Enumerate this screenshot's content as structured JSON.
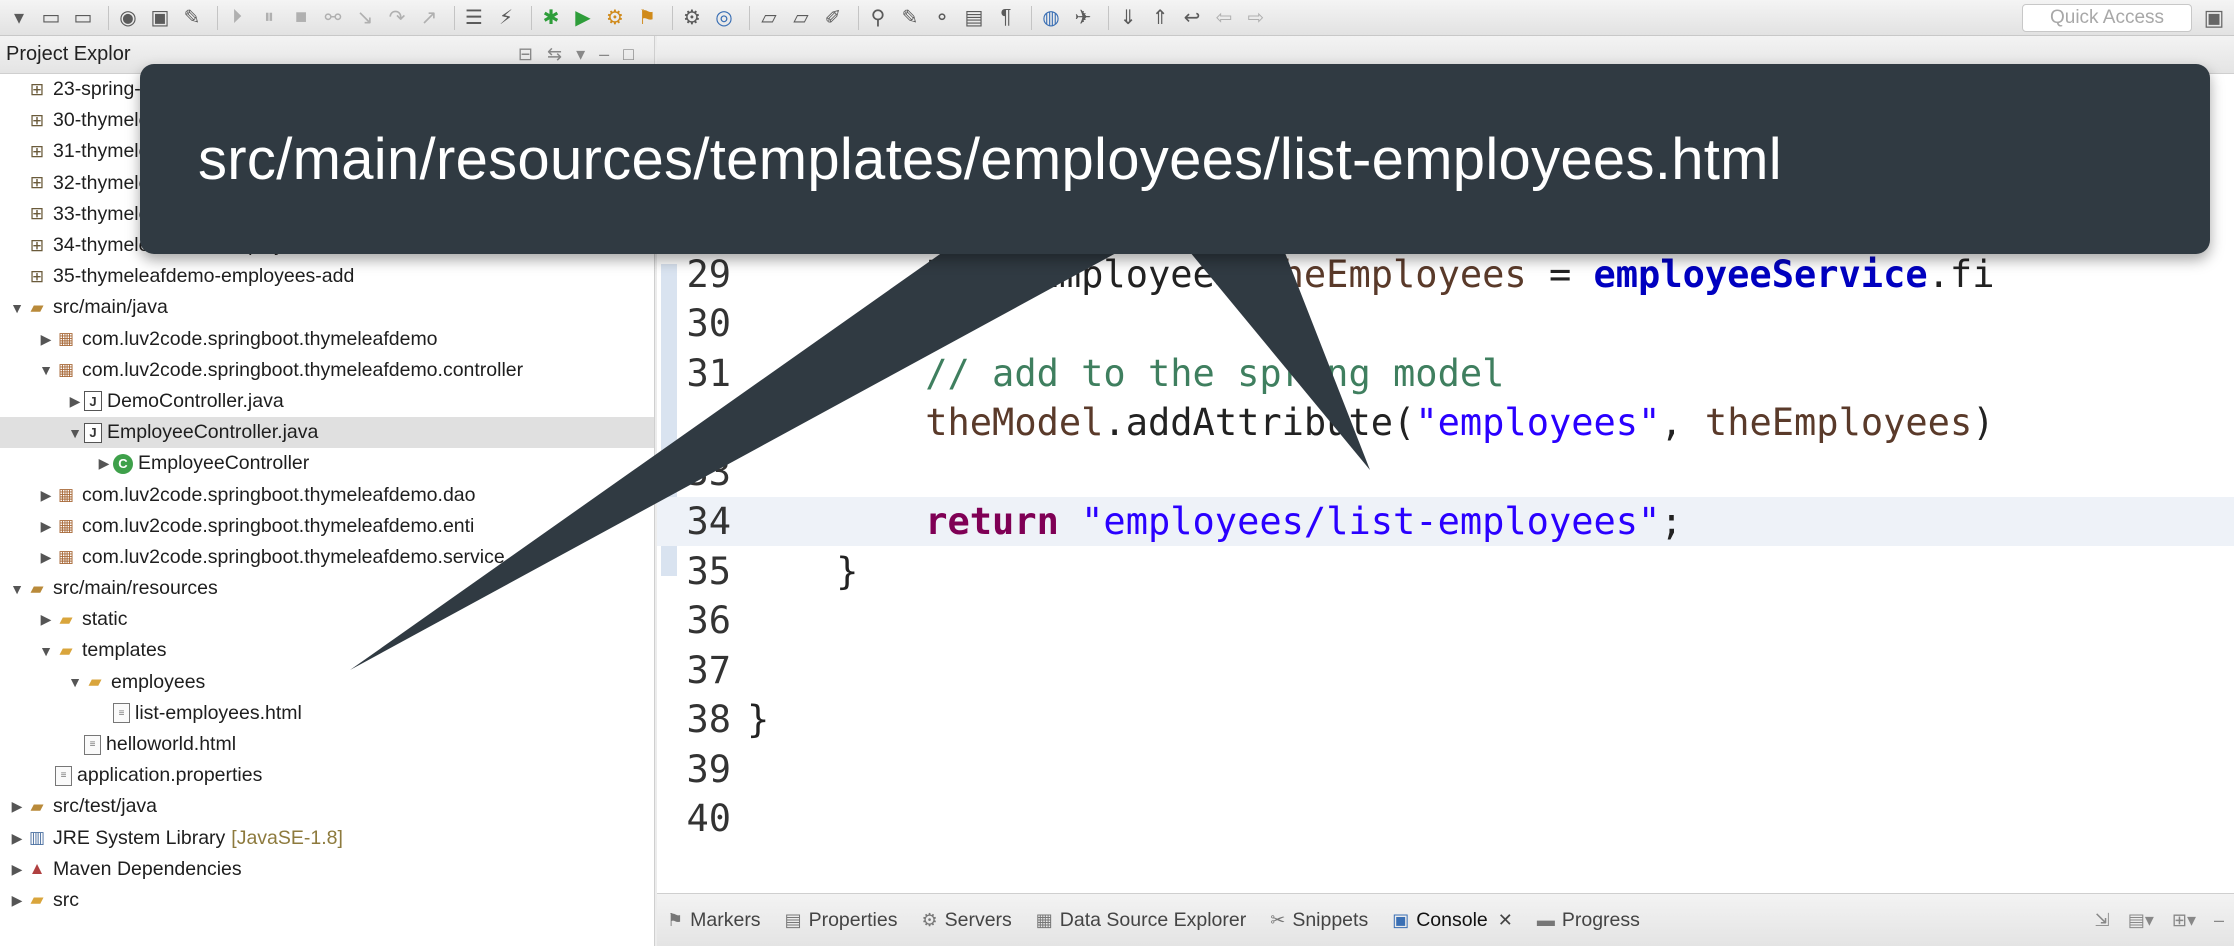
{
  "toolbar": {
    "icons": [
      "new-icon",
      "save-icon",
      "save-all-icon",
      "profile-icon",
      "monitor-icon",
      "pin-icon",
      "step-icon",
      "pause-icon",
      "stop-icon",
      "disconnect-icon",
      "step-into-icon",
      "step-over-icon",
      "step-return-icon",
      "tasks-icon",
      "refactor-icon",
      "debug-icon",
      "run-icon",
      "run-config-icon",
      "external-tools-icon",
      "new-server-icon",
      "new-class-icon",
      "open-folder-icon",
      "open-type-icon",
      "open-resource-icon",
      "search-icon",
      "highlight-icon",
      "toggle-icon",
      "mark-icon",
      "show-whitespace-icon",
      "globe-icon",
      "web-icon",
      "next-annotation-icon",
      "prev-annotation-icon",
      "last-edit-icon",
      "back-icon",
      "forward-icon"
    ],
    "quick_access_placeholder": "Quick Access"
  },
  "explorer": {
    "tab_label": "Project Explor",
    "items": [
      {
        "label": "23-spring-",
        "icon": "project-icon",
        "depth": 0,
        "arrow": ""
      },
      {
        "label": "30-thymele",
        "icon": "project-icon",
        "depth": 0,
        "arrow": ""
      },
      {
        "label": "31-thymele",
        "icon": "project-icon",
        "depth": 0,
        "arrow": ""
      },
      {
        "label": "32-thymele",
        "icon": "project-icon",
        "depth": 0,
        "arrow": ""
      },
      {
        "label": "33-thymele",
        "icon": "project-icon",
        "depth": 0,
        "arrow": ""
      },
      {
        "label": "34-thymeleafdemo-employees-list-db",
        "icon": "project-icon",
        "depth": 0,
        "arrow": ""
      },
      {
        "label": "35-thymeleafdemo-employees-add",
        "icon": "project-icon",
        "depth": 0,
        "arrow": ""
      },
      {
        "label": "src/main/java",
        "icon": "source-folder-icon",
        "depth": 0,
        "arrow": "▼"
      },
      {
        "label": "com.luv2code.springboot.thymeleafdemo",
        "icon": "package-icon",
        "depth": 1,
        "arrow": "▶"
      },
      {
        "label": "com.luv2code.springboot.thymeleafdemo.controller",
        "icon": "package-icon",
        "depth": 1,
        "arrow": "▼"
      },
      {
        "label": "DemoController.java",
        "icon": "java-file-icon",
        "depth": 2,
        "arrow": "▶"
      },
      {
        "label": "EmployeeController.java",
        "icon": "java-file-icon",
        "depth": 2,
        "arrow": "▼",
        "selected": true
      },
      {
        "label": "EmployeeController",
        "icon": "class-icon",
        "depth": 3,
        "arrow": "▶"
      },
      {
        "label": "com.luv2code.springboot.thymeleafdemo.dao",
        "icon": "package-icon",
        "depth": 1,
        "arrow": "▶"
      },
      {
        "label": "com.luv2code.springboot.thymeleafdemo.enti",
        "icon": "package-icon",
        "depth": 1,
        "arrow": "▶"
      },
      {
        "label": "com.luv2code.springboot.thymeleafdemo.service",
        "icon": "package-icon",
        "depth": 1,
        "arrow": "▶"
      },
      {
        "label": "src/main/resources",
        "icon": "source-folder-icon",
        "depth": 0,
        "arrow": "▼"
      },
      {
        "label": "static",
        "icon": "folder-icon",
        "depth": 1,
        "arrow": "▶"
      },
      {
        "label": "templates",
        "icon": "folder-icon",
        "depth": 1,
        "arrow": "▼"
      },
      {
        "label": "employees",
        "icon": "folder-icon",
        "depth": 2,
        "arrow": "▼"
      },
      {
        "label": "list-employees.html",
        "icon": "html-file-icon",
        "depth": 3,
        "arrow": ""
      },
      {
        "label": "helloworld.html",
        "icon": "html-file-icon",
        "depth": 2,
        "arrow": ""
      },
      {
        "label": "application.properties",
        "icon": "properties-file-icon",
        "depth": 1,
        "arrow": ""
      },
      {
        "label": "src/test/java",
        "icon": "source-folder-icon",
        "depth": 0,
        "arrow": "▶"
      },
      {
        "label": "JRE System Library",
        "suffix": "[JavaSE-1.8]",
        "icon": "library-icon",
        "depth": 0,
        "arrow": "▶"
      },
      {
        "label": "Maven Dependencies",
        "icon": "maven-icon",
        "depth": 0,
        "arrow": "▶"
      },
      {
        "label": "src",
        "icon": "folder-icon",
        "depth": 0,
        "arrow": "▶"
      }
    ]
  },
  "editor": {
    "lines": [
      {
        "num": "29",
        "segments": [
          {
            "t": "        ",
            "c": "plain"
          },
          {
            "t": "List<Employee> ",
            "c": "plain"
          },
          {
            "t": "theEmployees",
            "c": "var"
          },
          {
            "t": " = ",
            "c": "plain"
          },
          {
            "t": "employeeService",
            "c": "fld"
          },
          {
            "t": ".fi",
            "c": "plain"
          }
        ]
      },
      {
        "num": "30",
        "segments": []
      },
      {
        "num": "31",
        "segments": [
          {
            "t": "        ",
            "c": "plain"
          },
          {
            "t": "// add to the spring model",
            "c": "com"
          }
        ]
      },
      {
        "num": "",
        "segments": [
          {
            "t": "        ",
            "c": "plain"
          },
          {
            "t": "theModel",
            "c": "var"
          },
          {
            "t": ".addAttribute(",
            "c": "plain"
          },
          {
            "t": "\"employees\"",
            "c": "str"
          },
          {
            "t": ", ",
            "c": "plain"
          },
          {
            "t": "theEmployees",
            "c": "var"
          },
          {
            "t": ")",
            "c": "plain"
          }
        ]
      },
      {
        "num": "33",
        "segments": []
      },
      {
        "num": "34",
        "segments": [
          {
            "t": "        ",
            "c": "plain"
          },
          {
            "t": "return",
            "c": "kw"
          },
          {
            "t": " ",
            "c": "plain"
          },
          {
            "t": "\"employees/list-employees\"",
            "c": "str"
          },
          {
            "t": ";",
            "c": "plain"
          }
        ],
        "current": true
      },
      {
        "num": "35",
        "segments": [
          {
            "t": "    }",
            "c": "plain"
          }
        ]
      },
      {
        "num": "36",
        "segments": []
      },
      {
        "num": "37",
        "segments": []
      },
      {
        "num": "38",
        "segments": [
          {
            "t": "}",
            "c": "plain"
          }
        ]
      },
      {
        "num": "39",
        "segments": []
      },
      {
        "num": "40",
        "segments": []
      }
    ]
  },
  "bottom_panel": {
    "tabs": [
      {
        "label": "Markers",
        "icon": "markers-icon"
      },
      {
        "label": "Properties",
        "icon": "properties-icon"
      },
      {
        "label": "Servers",
        "icon": "servers-icon"
      },
      {
        "label": "Data Source Explorer",
        "icon": "data-source-icon"
      },
      {
        "label": "Snippets",
        "icon": "snippets-icon"
      },
      {
        "label": "Console",
        "icon": "console-icon",
        "active": true
      },
      {
        "label": "Progress",
        "icon": "progress-icon"
      }
    ]
  },
  "callout": {
    "text": "src/main/resources/templates/employees/list-employees.html",
    "color": "#303a42"
  }
}
